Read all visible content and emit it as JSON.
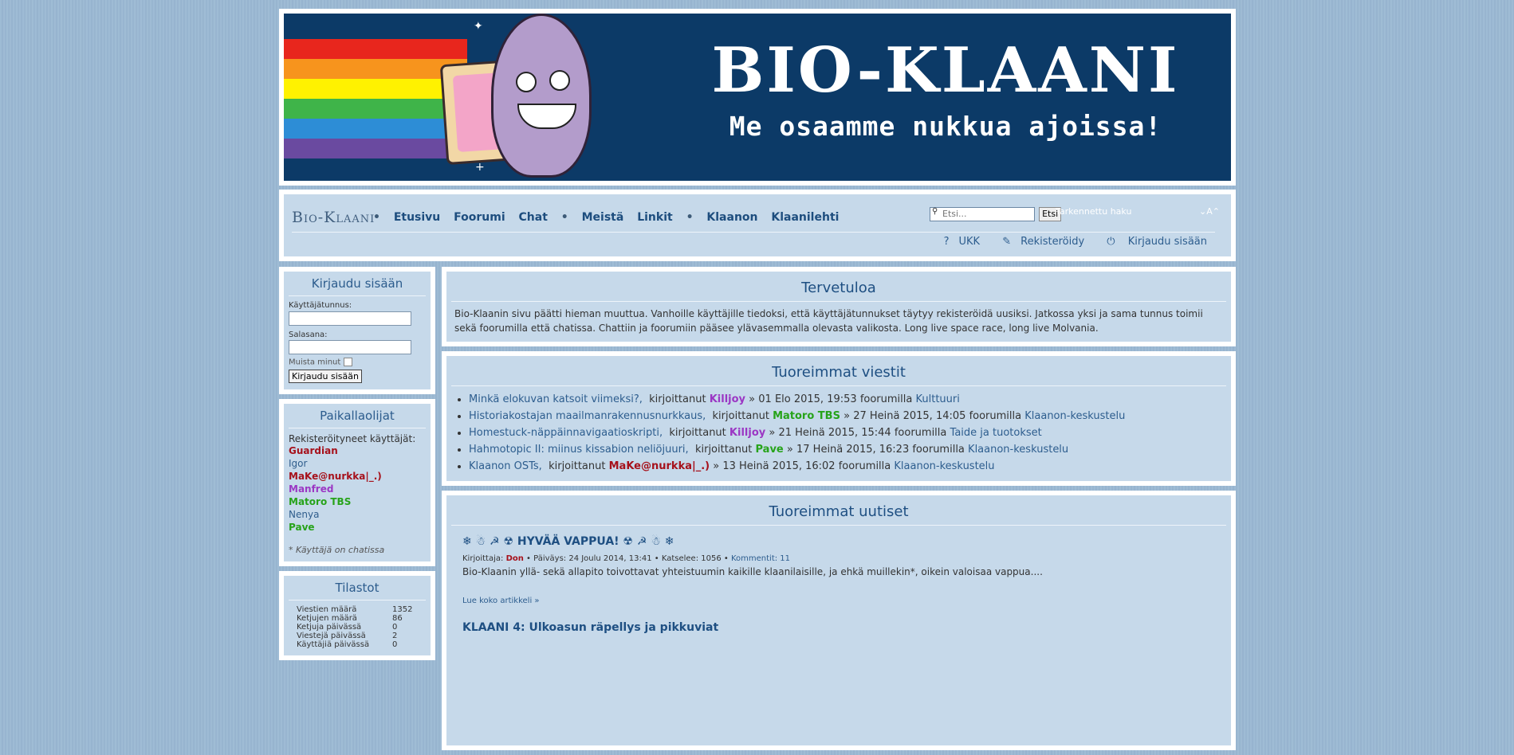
{
  "banner": {
    "title": "BIO-KLAANI",
    "subtitle": "Me osaamme nukkua ajoissa!"
  },
  "nav": {
    "site_name": "Bio-Klaani",
    "links": [
      "Etusivu",
      "Foorumi",
      "Chat",
      "Meistä",
      "Linkit",
      "Klaanon",
      "Klaanilehti"
    ],
    "search_placeholder": "Etsi...",
    "search_button": "Etsi",
    "advanced_search": "Tarkennettu haku",
    "font_size_label": "A",
    "user_links": [
      "UKK",
      "Rekisteröidy",
      "Kirjaudu sisään"
    ]
  },
  "login": {
    "title": "Kirjaudu sisään",
    "username_label": "Käyttäjätunnus:",
    "password_label": "Salasana:",
    "remember_label": "Muista minut",
    "submit_label": "Kirjaudu sisään"
  },
  "online": {
    "title": "Paikallaolijat",
    "registered_label": "Rekisteröityneet käyttäjät:",
    "users": [
      {
        "name": "Guardian",
        "style": "u-red"
      },
      {
        "name": "Igor",
        "style": "u-blue"
      },
      {
        "name": "MaKe@nurkka|_.)",
        "style": "u-red"
      },
      {
        "name": "Manfred",
        "style": "u-purple"
      },
      {
        "name": "Matoro TBS",
        "style": "u-green"
      },
      {
        "name": "Nenya",
        "style": "u-blue"
      },
      {
        "name": "Pave",
        "style": "u-green"
      }
    ],
    "note": "* Käyttäjä on chatissa"
  },
  "stats": {
    "title": "Tilastot",
    "rows": [
      {
        "label": "Viestien määrä",
        "value": "1352"
      },
      {
        "label": "Ketjujen määrä",
        "value": "86"
      },
      {
        "label": "Ketjuja päivässä",
        "value": "0"
      },
      {
        "label": "Viestejä päivässä",
        "value": "2"
      },
      {
        "label": "Käyttäjiä päivässä",
        "value": "0"
      }
    ]
  },
  "welcome": {
    "title": "Tervetuloa",
    "text": "Bio-Klaanin sivu päätti hieman muuttua. Vanhoille käyttäjille tiedoksi, että käyttäjätunnukset täytyy rekisteröidä uusiksi. Jatkossa yksi ja sama tunnus toimii sekä foorumilla että chatissa. Chattiin ja foorumiin pääsee ylävasemmalla olevasta valikosta. Long live space race, long live Molvania."
  },
  "recent_posts": {
    "title": "Tuoreimmat viestit",
    "by_word": "kirjoittanut",
    "in_word": "foorumilla",
    "items": [
      {
        "topic": "Minkä elokuvan katsoit viimeksi?,",
        "author": "Killjoy",
        "author_style": "u-purple",
        "date": "01 Elo 2015, 19:53",
        "forum": "Kulttuuri"
      },
      {
        "topic": "Historiakostajan maailmanrakennusnurkkaus,",
        "author": "Matoro TBS",
        "author_style": "u-green",
        "date": "27 Heinä 2015, 14:05",
        "forum": "Klaanon-keskustelu"
      },
      {
        "topic": "Homestuck-näppäinnavigaatioskripti,",
        "author": "Killjoy",
        "author_style": "u-purple",
        "date": "21 Heinä 2015, 15:44",
        "forum": "Taide ja tuotokset"
      },
      {
        "topic": "Hahmotopic II: miinus kissabion neliöjuuri,",
        "author": "Pave",
        "author_style": "u-green",
        "date": "17 Heinä 2015, 16:23",
        "forum": "Klaanon-keskustelu"
      },
      {
        "topic": "Klaanon OSTs,",
        "author": "MaKe@nurkka|_.)",
        "author_style": "u-red",
        "date": "13 Heinä 2015, 16:02",
        "forum": "Klaanon-keskustelu"
      }
    ]
  },
  "news": {
    "title": "Tuoreimmat uutiset",
    "article1": {
      "title": "❄ ☃ ☭ ☢ HYVÄÄ VAPPUA! ☢ ☭ ☃ ❄",
      "author_label": "Kirjoittaja:",
      "author": "Don",
      "date_label": "• Päiväys: 24 Joulu 2014, 13:41 • Katselee: 1056 •",
      "comments": "Kommentit: 11",
      "body": "Bio-Klaanin yllä- sekä allapito toivottavat yhteistuumin kaikille klaanilaisille, ja ehkä muillekin*, oikein valoisaa vappua....",
      "more": "Lue koko artikkeli »"
    },
    "article2_title": "KLAANI 4: Ulkoasun räpellys ja pikkuviat"
  },
  "colors": {
    "page_bg": "#9ab8d3",
    "panel_bg": "#c6d9ea",
    "banner_bg": "#0c3a67",
    "link": "#2d5d8e",
    "title": "#1e4f82"
  }
}
